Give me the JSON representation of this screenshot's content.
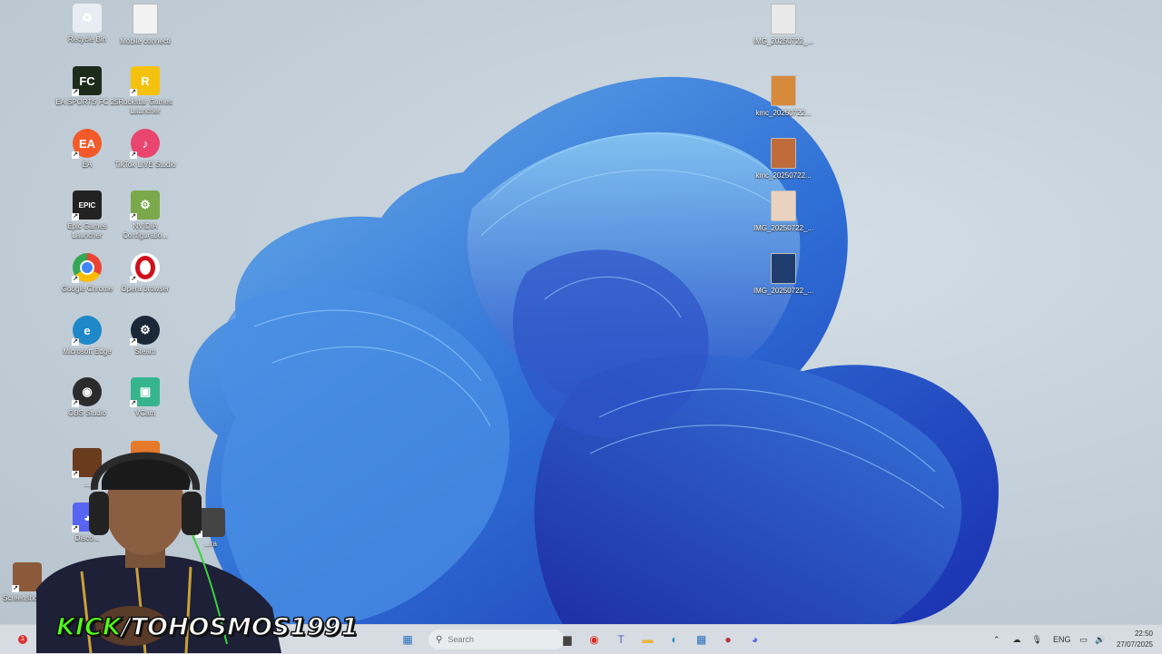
{
  "desktop": {
    "left_icons": [
      {
        "label": "Recycle Bin",
        "icon": "recycle-bin-icon",
        "color": "#e7edf2",
        "glyph": "♻"
      },
      {
        "label": "Mobile connecti",
        "icon": "file-icon",
        "color": "#f2f2f2",
        "glyph": ""
      },
      {
        "label": "EA SPORTS FC 25",
        "icon": "ea-sports-fc-icon",
        "color": "#1d2b1a",
        "glyph": "FC"
      },
      {
        "label": "Rockstar Games Launcher",
        "icon": "rockstar-icon",
        "color": "#f4c20d",
        "glyph": "R"
      },
      {
        "label": "EA",
        "icon": "ea-icon",
        "color": "#f25a2a",
        "glyph": "EA"
      },
      {
        "label": "TikTok LIVE Studio",
        "icon": "tiktok-live-icon",
        "color": "#e8466f",
        "glyph": "♪"
      },
      {
        "label": "Epic Games Launcher",
        "icon": "epic-games-icon",
        "color": "#222222",
        "glyph": "EPIC"
      },
      {
        "label": "NVIDIA Configuratio...",
        "icon": "nvidia-config-icon",
        "color": "#7aa84a",
        "glyph": "⚙"
      },
      {
        "label": "Google Chrome",
        "icon": "chrome-icon",
        "color": "#ffffff",
        "glyph": ""
      },
      {
        "label": "Opera browser",
        "icon": "opera-icon",
        "color": "#ffffff",
        "glyph": "O"
      },
      {
        "label": "Microsoft Edge",
        "icon": "edge-icon",
        "color": "#1e88c8",
        "glyph": "e"
      },
      {
        "label": "Steam",
        "icon": "steam-icon",
        "color": "#1b2838",
        "glyph": "⚙"
      },
      {
        "label": "OBS Studio",
        "icon": "obs-icon",
        "color": "#2b2b2b",
        "glyph": "◉"
      },
      {
        "label": "VCam",
        "icon": "vcam-icon",
        "color": "#36b58d",
        "glyph": "▣"
      },
      {
        "label": "...",
        "icon": "game-thumbnail-icon",
        "color": "#6b3b1e",
        "glyph": ""
      },
      {
        "label": "",
        "icon": "orange-app-icon",
        "color": "#e57a2a",
        "glyph": ""
      },
      {
        "label": "Disco...",
        "icon": "discord-icon",
        "color": "#5865f2",
        "glyph": "◕"
      },
      {
        "label": "...ra",
        "icon": "app-icon",
        "color": "#444",
        "glyph": ""
      },
      {
        "label": "Screenshot 2...",
        "icon": "screenshot-file-icon",
        "color": "#8a5a3a",
        "glyph": ""
      }
    ],
    "right_icons": [
      {
        "label": "IMG_20250722_...",
        "icon": "image-file-icon",
        "color": "#e9e9e9",
        "glyph": ""
      },
      {
        "label": "kmc_20250722...",
        "icon": "image-file-icon",
        "color": "#d88a3c",
        "glyph": ""
      },
      {
        "label": "kmc_20250722...",
        "icon": "image-file-icon",
        "color": "#c06b3a",
        "glyph": ""
      },
      {
        "label": "IMG_20250722_...",
        "icon": "image-file-icon",
        "color": "#e9d3c0",
        "glyph": ""
      },
      {
        "label": "IMG_20250722_...",
        "icon": "image-file-icon",
        "color": "#1f3c6e",
        "glyph": ""
      }
    ]
  },
  "taskbar": {
    "search_placeholder": "Search",
    "apps": [
      {
        "name": "file-manager-icon",
        "glyph": "▆",
        "color": "#444"
      },
      {
        "name": "chrome-icon",
        "glyph": "◉",
        "color": "#d93025"
      },
      {
        "name": "teams-icon",
        "glyph": "T",
        "color": "#5b5fc7"
      },
      {
        "name": "file-explorer-icon",
        "glyph": "▬",
        "color": "#e8b43c"
      },
      {
        "name": "edge-icon",
        "glyph": "◐",
        "color": "#1e88c8"
      },
      {
        "name": "store-icon",
        "glyph": "▦",
        "color": "#2a6ebb"
      },
      {
        "name": "app-red-icon",
        "glyph": "●",
        "color": "#b03030"
      },
      {
        "name": "discord-icon",
        "glyph": "◕",
        "color": "#5865f2"
      }
    ],
    "tray": {
      "language": "ENG",
      "time": "22:50",
      "date": "27/07/2025"
    }
  },
  "overlay": {
    "kick_prefix": "KICK",
    "kick_handle": "/TOHOSMOS1991",
    "brand_color": "#53fc18"
  }
}
